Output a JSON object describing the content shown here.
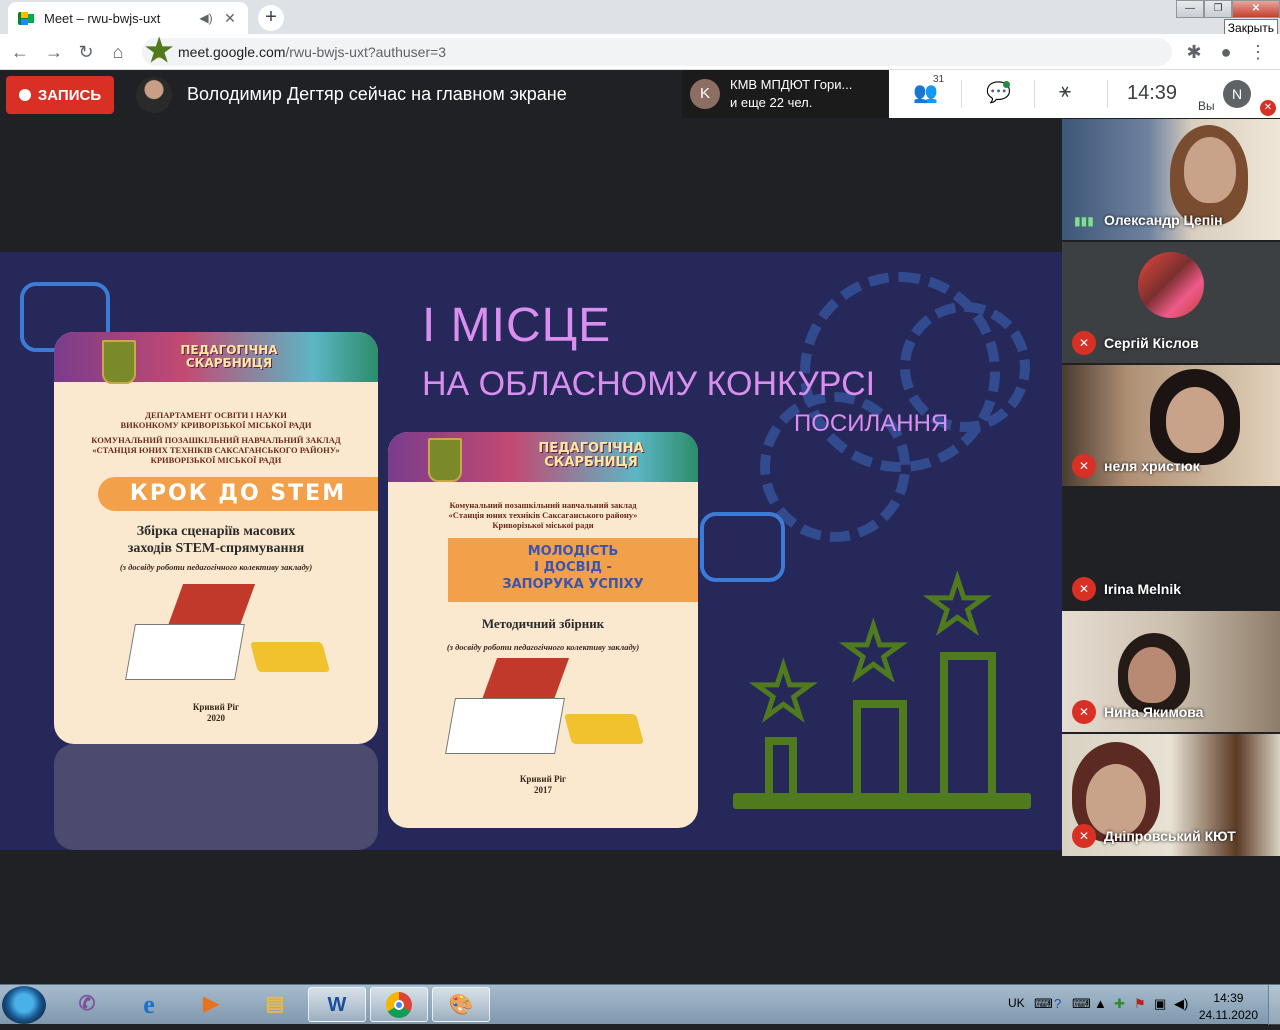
{
  "browser": {
    "tab_title": "Meet – rwu-bwjs-uxt",
    "url_host": "meet.google.com",
    "url_path": "/rwu-bwjs-uxt?authuser=3",
    "close_tooltip": "Закрыть"
  },
  "meet": {
    "record_label": "ЗАПИСЬ",
    "presenting_text": "Володимир Дегтяр сейчас на главном экране",
    "chip_initial": "K",
    "chip_line1": "КМВ МПДЮТ Гори...",
    "chip_line2": "и еще 22 чел.",
    "participants_count": "31",
    "clock": "14:39",
    "you_label": "Вы",
    "me_initial": "N"
  },
  "slide": {
    "title_line1": "І МІСЦЕ",
    "title_line2": "НА ОБЛАСНОМУ  КОНКУРСІ",
    "link_text": "ПОСИЛАННЯ",
    "book1": {
      "series": "ПЕДАГОГІЧНА СКАРБНИЦЯ",
      "dept": "ДЕПАРТАМЕНТ ОСВІТИ І НАУКИ\nВИКОНКОМУ КРИВОРІЗЬКОЇ МІСЬКОЇ РАДИ",
      "org": "КОМУНАЛЬНИЙ ПОЗАШКІЛЬНИЙ НАВЧАЛЬНИЙ ЗАКЛАД\n«СТАНЦІЯ ЮНИХ ТЕХНІКІВ САКСАГАНСЬКОГО РАЙОНУ»\nКРИВОРІЗЬКОЇ МІСЬКОЇ РАДИ",
      "title": "КРОК ДО STEM",
      "subtitle": "Збірка сценаріїв масових\nзаходів STEM-спрямування",
      "note": "(з досвіду роботи педагогічного колективу закладу)",
      "footer": "Кривий Ріг\n2020"
    },
    "book2": {
      "series": "ПЕДАГОГІЧНА СКАРБНИЦЯ",
      "org": "Комунальний позашкільний навчальний заклад\n«Станція юних техніків Саксаганського району»\nКриворізької міської ради",
      "title": "МОЛОДІСТЬ\nІ ДОСВІД -\nЗАПОРУКА УСПІХУ",
      "subtitle": "Методичний збірник",
      "note": "(з досвіду роботи педагогічного колективу закладу)",
      "footer": "Кривий Ріг\n2017"
    }
  },
  "participants": [
    {
      "name": "Олександр Цепін",
      "muted": false
    },
    {
      "name": "Сергій Кіслов",
      "muted": true
    },
    {
      "name": "неля христюк",
      "muted": true
    },
    {
      "name": "Irina Melnik",
      "muted": true
    },
    {
      "name": "Нина Якимова",
      "muted": true
    },
    {
      "name": "Дніпровський КЮТ",
      "muted": true
    }
  ],
  "taskbar": {
    "language": "UK",
    "time": "14:39",
    "date": "24.11.2020"
  }
}
